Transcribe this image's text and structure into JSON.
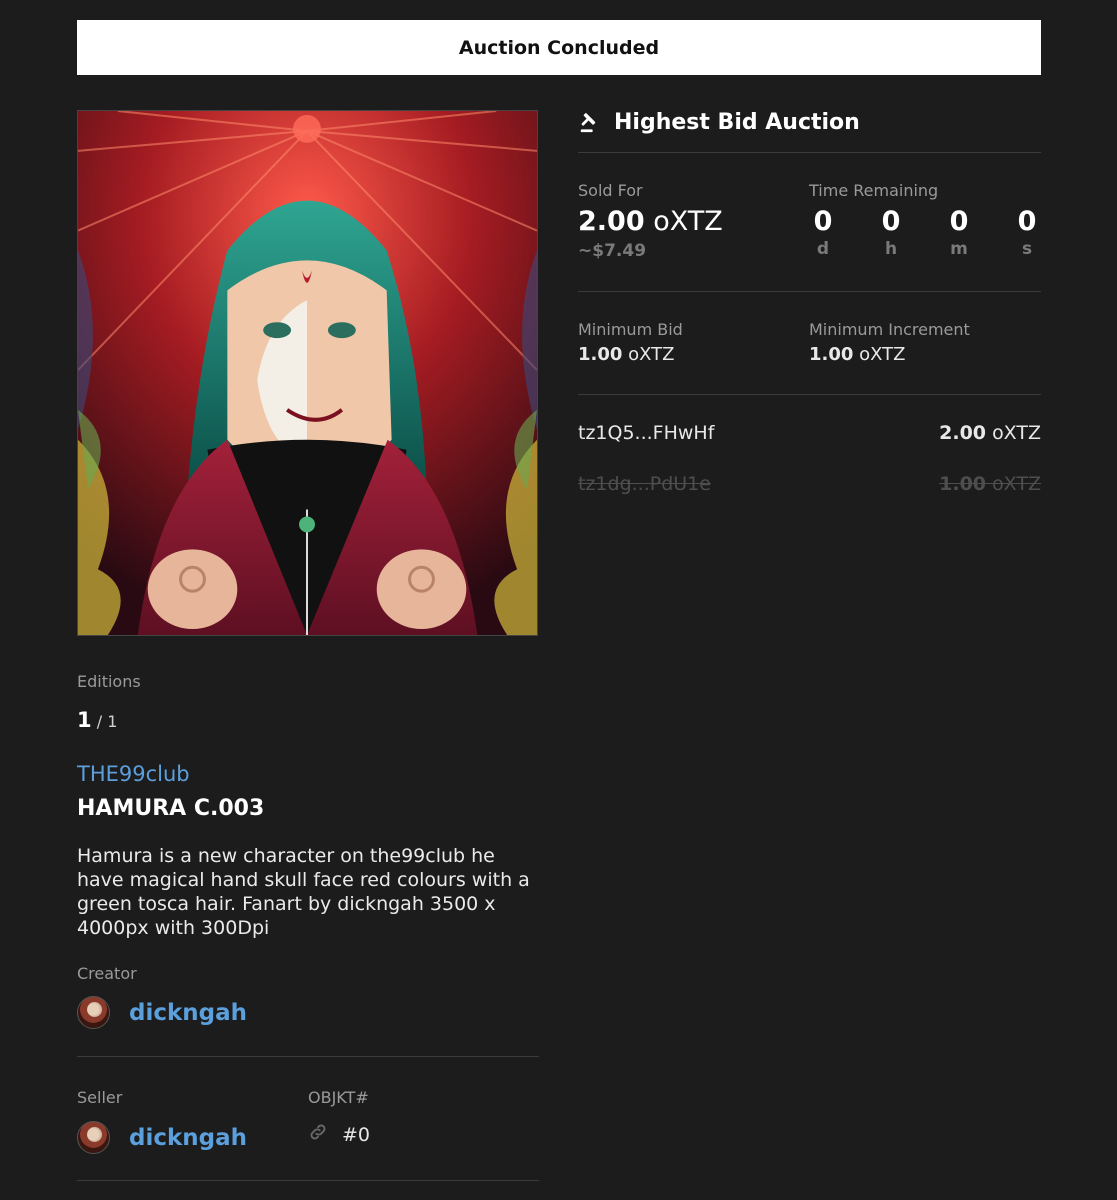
{
  "banner": {
    "text": "Auction Concluded"
  },
  "artwork": {
    "alt": "HAMURA C.003 artwork"
  },
  "editions": {
    "label": "Editions",
    "current": "1",
    "separator": " / ",
    "total": "1"
  },
  "collection": {
    "name": "THE99club"
  },
  "token": {
    "title": "HAMURA C.003",
    "description": "Hamura is a new character on the99club he have magical hand skull face red colours with a green tosca hair. Fanart by dickngah 3500 x 4000px with 300Dpi"
  },
  "creator": {
    "label": "Creator",
    "name": "dickngah"
  },
  "seller": {
    "label": "Seller",
    "name": "dickngah"
  },
  "objkt": {
    "label": "OBJKT#",
    "value": "#0"
  },
  "auction": {
    "title": "Highest Bid Auction",
    "icon": "gavel-icon",
    "sold_label": "Sold For",
    "sold_amount": "2.00",
    "currency": "oXTZ",
    "sold_usd": "~$7.49",
    "time_label": "Time Remaining",
    "time": [
      {
        "value": "0",
        "unit": "d"
      },
      {
        "value": "0",
        "unit": "h"
      },
      {
        "value": "0",
        "unit": "m"
      },
      {
        "value": "0",
        "unit": "s"
      }
    ],
    "min_bid_label": "Minimum Bid",
    "min_bid_amount": "1.00",
    "min_inc_label": "Minimum Increment",
    "min_inc_amount": "1.00"
  },
  "bids": [
    {
      "address": "tz1Q5...FHwHf",
      "amount": "2.00",
      "currency": "oXTZ"
    },
    {
      "address": "tz1dg...PdU1e",
      "amount": "1.00",
      "currency": "oXTZ"
    }
  ],
  "colors": {
    "accent_link": "#5b9fdc",
    "background": "#1c1c1c"
  }
}
